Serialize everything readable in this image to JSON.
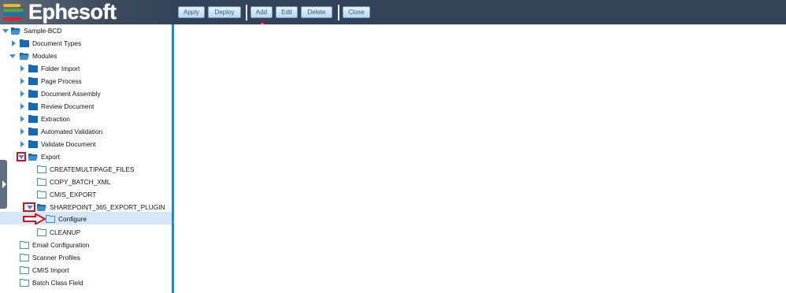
{
  "app": {
    "logo_text": "Ephesoft",
    "logo_colors": [
      "#f2b420",
      "#4aa83d",
      "#1f6fb5",
      "#d8262c"
    ]
  },
  "toolbar": {
    "apply_label": "Apply",
    "deploy_label": "Deploy",
    "add_label": "Add",
    "edit_label": "Edit",
    "delete_label": "Delete",
    "close_label": "Close"
  },
  "tree": {
    "root": "Sample-BCD",
    "document_types": "Document Types",
    "modules": "Modules",
    "folder_import": "Folder Import",
    "page_process": "Page Process",
    "document_assembly": "Document Assembly",
    "review_document": "Review Document",
    "extraction": "Extraction",
    "automated_validation": "Automated Validation",
    "validate_document": "Validate Document",
    "export": "Export",
    "createmultipage_files": "CREATEMULTIPAGE_FILES",
    "copy_batch_xml": "COPY_BATCH_XML",
    "cmis_export": "CMIS_EXPORT",
    "sharepoint_plugin": "SHAREPOINT_365_EXPORT_PLUGIN",
    "configure": "Configure",
    "cleanup": "CLEANUP",
    "email_configuration": "Email Configuration",
    "scanner_profiles": "Scanner Profiles",
    "cmis_import": "CMIS Import",
    "batch_class_field": "Batch Class Field"
  },
  "colors": {
    "header_bg": "#33445a",
    "accent": "#1b87d5",
    "selected_row": "#d4e6f8",
    "annotation_red": "#d7101f"
  }
}
